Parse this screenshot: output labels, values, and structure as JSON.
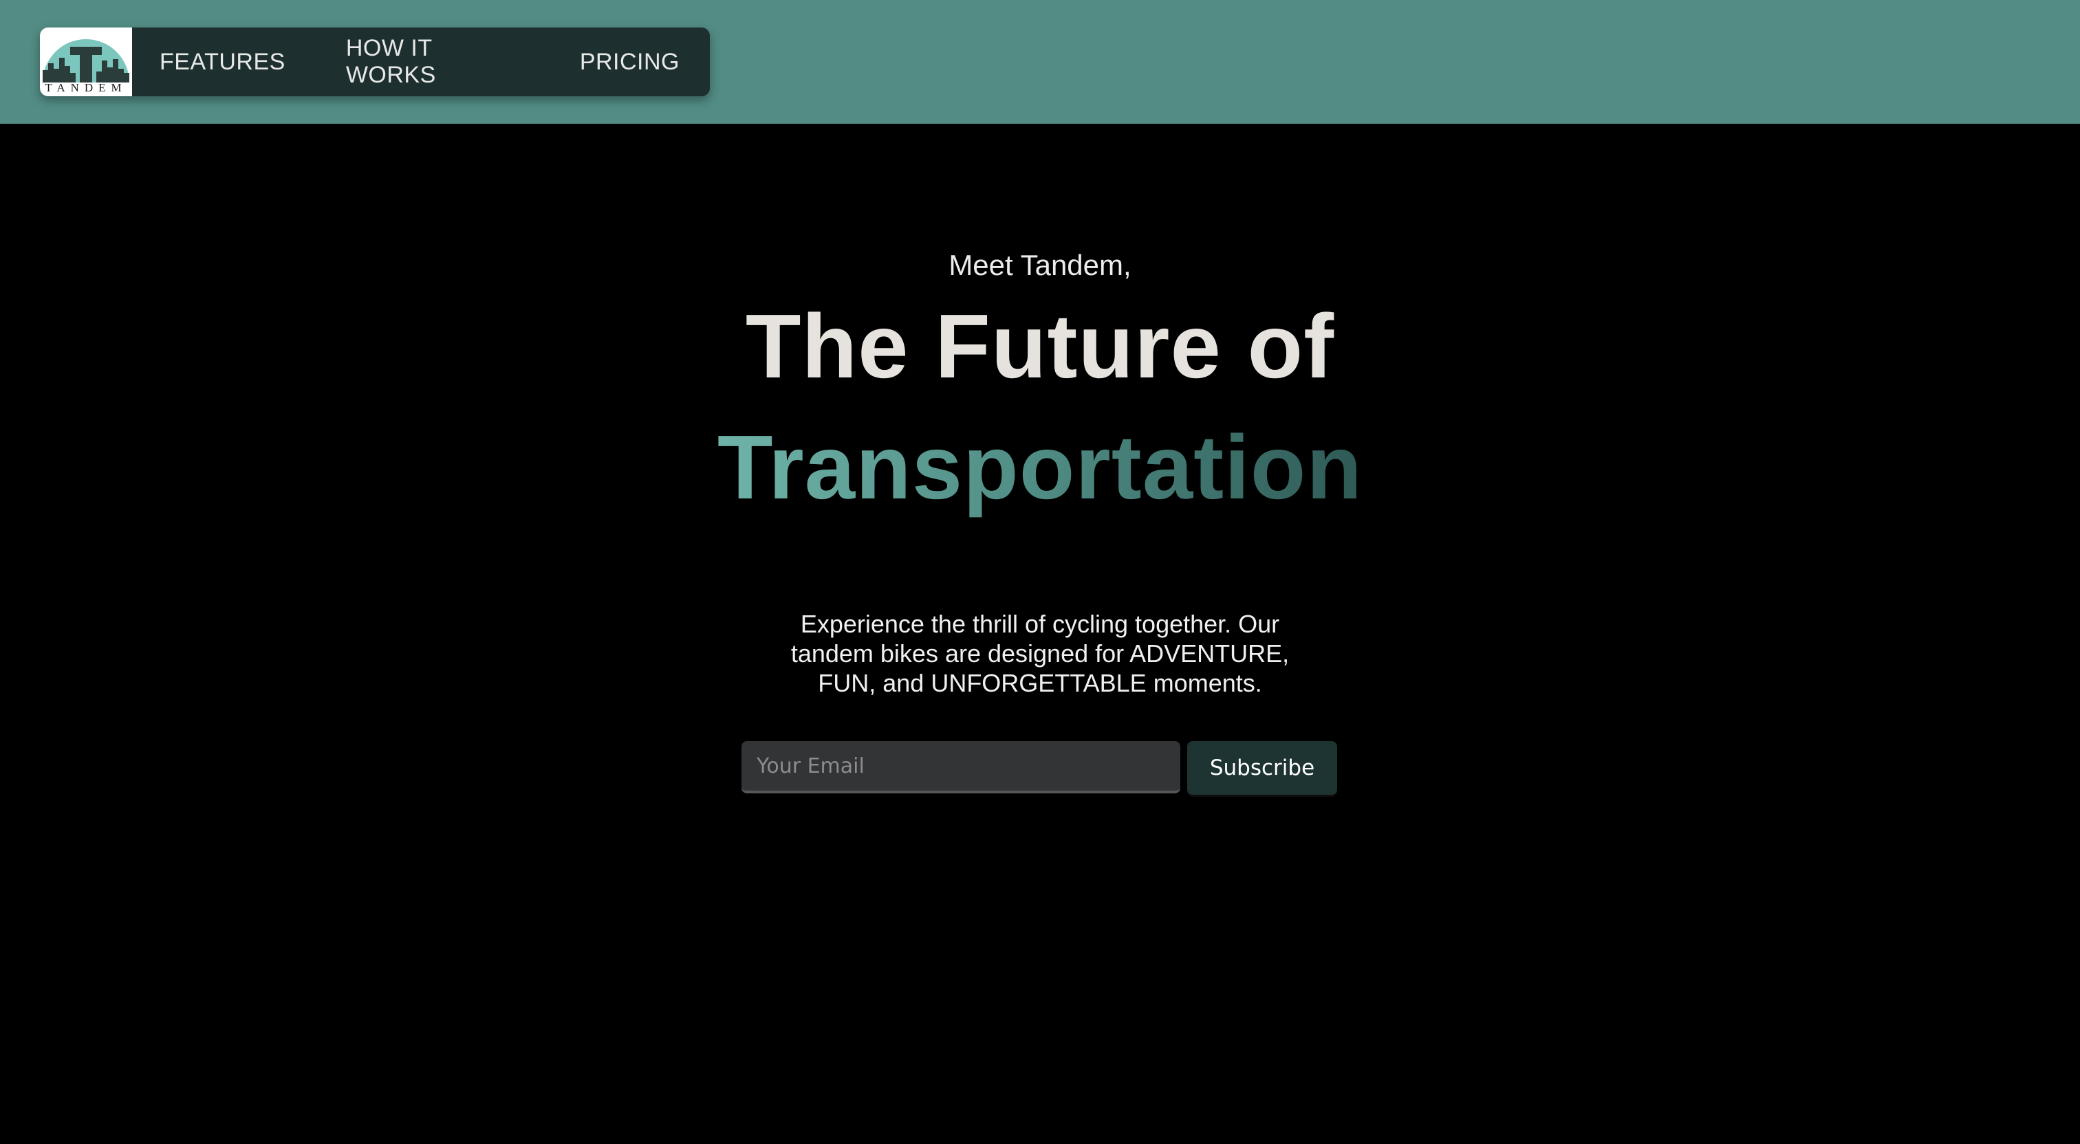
{
  "colors": {
    "topbar": "#528c84",
    "nav_bg": "#1d302f",
    "accent_gradient_start": "#6fb3a8",
    "accent_gradient_end": "#2f5a56",
    "button_bg": "#1e3432"
  },
  "brand": {
    "name": "TANDEM",
    "logo_icon": "tandem-skyline-logo-icon"
  },
  "nav": {
    "items": [
      {
        "label": "FEATURES"
      },
      {
        "label": "HOW IT WORKS"
      },
      {
        "label": "PRICING"
      }
    ]
  },
  "hero": {
    "eyebrow": "Meet Tandem,",
    "headline": "The Future of",
    "headline_accent": "Transportation",
    "description": "Experience the thrill of cycling together. Our tandem bikes are designed for ADVENTURE, FUN, and UNFORGETTABLE moments."
  },
  "subscribe": {
    "placeholder": "Your Email",
    "value": "",
    "button_label": "Subscribe"
  }
}
